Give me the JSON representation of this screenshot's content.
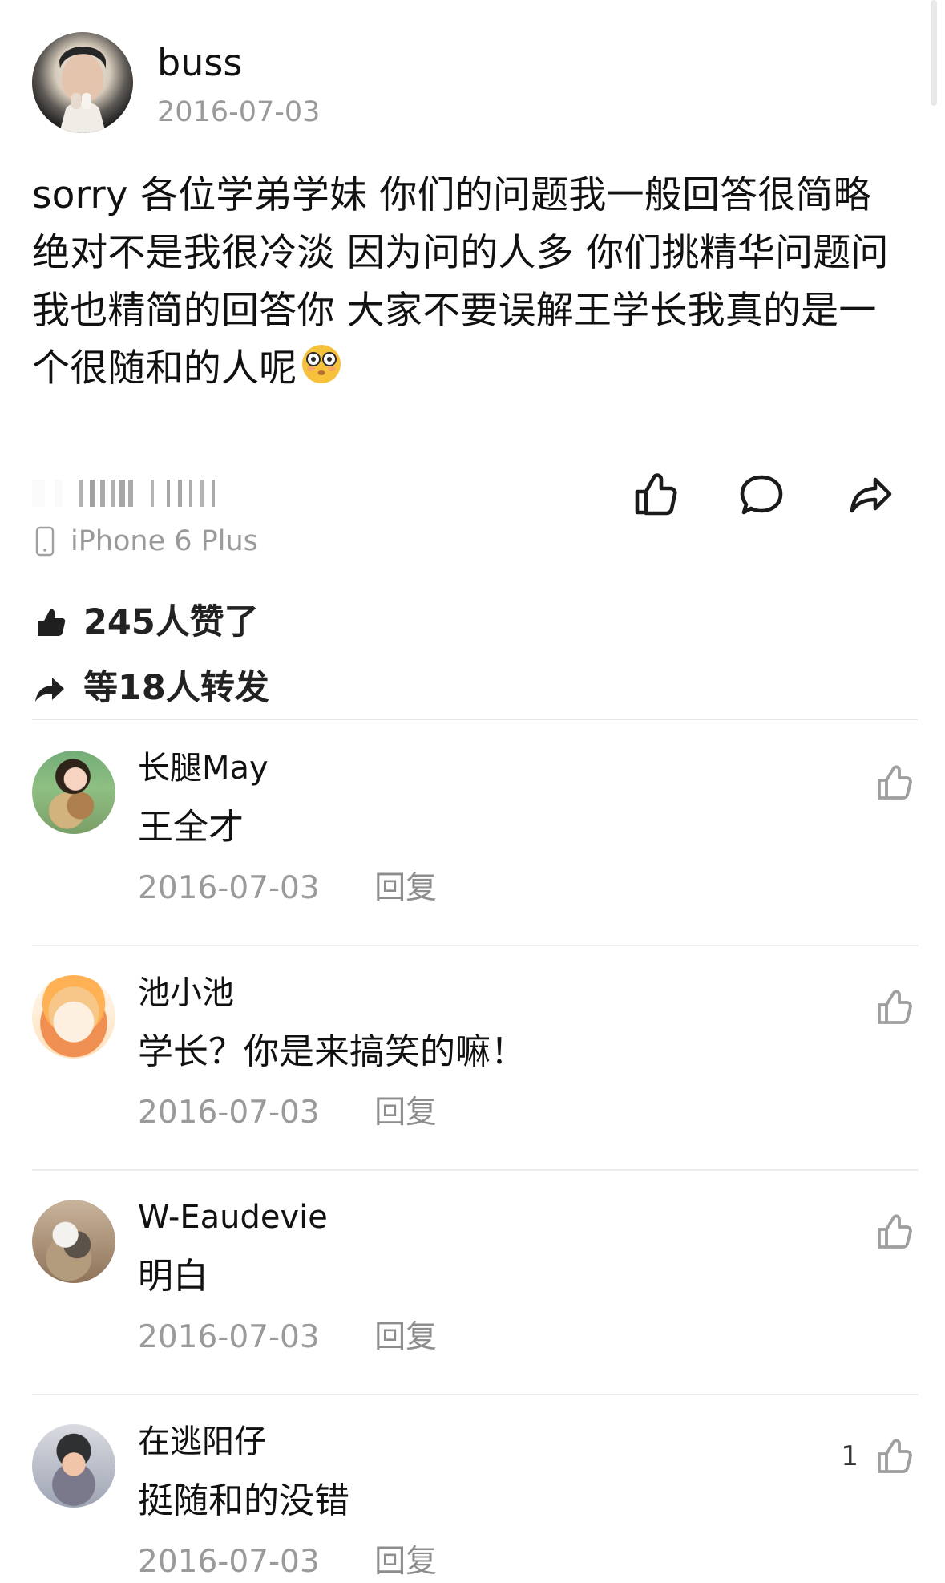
{
  "post": {
    "author": {
      "name": "buss",
      "date": "2016-07-03"
    },
    "content": {
      "text": "sorry 各位学弟学妹 你们的问题我一般回答很简略绝对不是我很冷淡 因为问的人多 你们挑精华问题问 我也精简的回答你 大家不要误解王学长我真的是一个很随和的人呢"
    },
    "device": "iPhone 6 Plus",
    "stats": {
      "likes": "245人赞了",
      "shares": "等18人转发"
    },
    "icons": {
      "like": "thumb-up-icon",
      "comment": "comment-icon",
      "share": "share-icon",
      "device": "phone-icon",
      "emoji": "flushed-face-icon"
    }
  },
  "comments": [
    {
      "name": "长腿May",
      "body": "王全才",
      "date": "2016-07-03",
      "reply": "回复",
      "likes": ""
    },
    {
      "name": "池小池",
      "body": "学长？你是来搞笑的嘛！",
      "date": "2016-07-03",
      "reply": "回复",
      "likes": ""
    },
    {
      "name": "W-Eaudevie",
      "body": "明白",
      "date": "2016-07-03",
      "reply": "回复",
      "likes": ""
    },
    {
      "name": "在逃阳仔",
      "body": "挺随和的没错",
      "date": "2016-07-03",
      "reply": "回复",
      "likes": "1"
    }
  ],
  "colors": {
    "text": "#111111",
    "secondary": "#9a9a9a",
    "divider": "#e6e6e6",
    "emoji": "#f7c23b"
  }
}
